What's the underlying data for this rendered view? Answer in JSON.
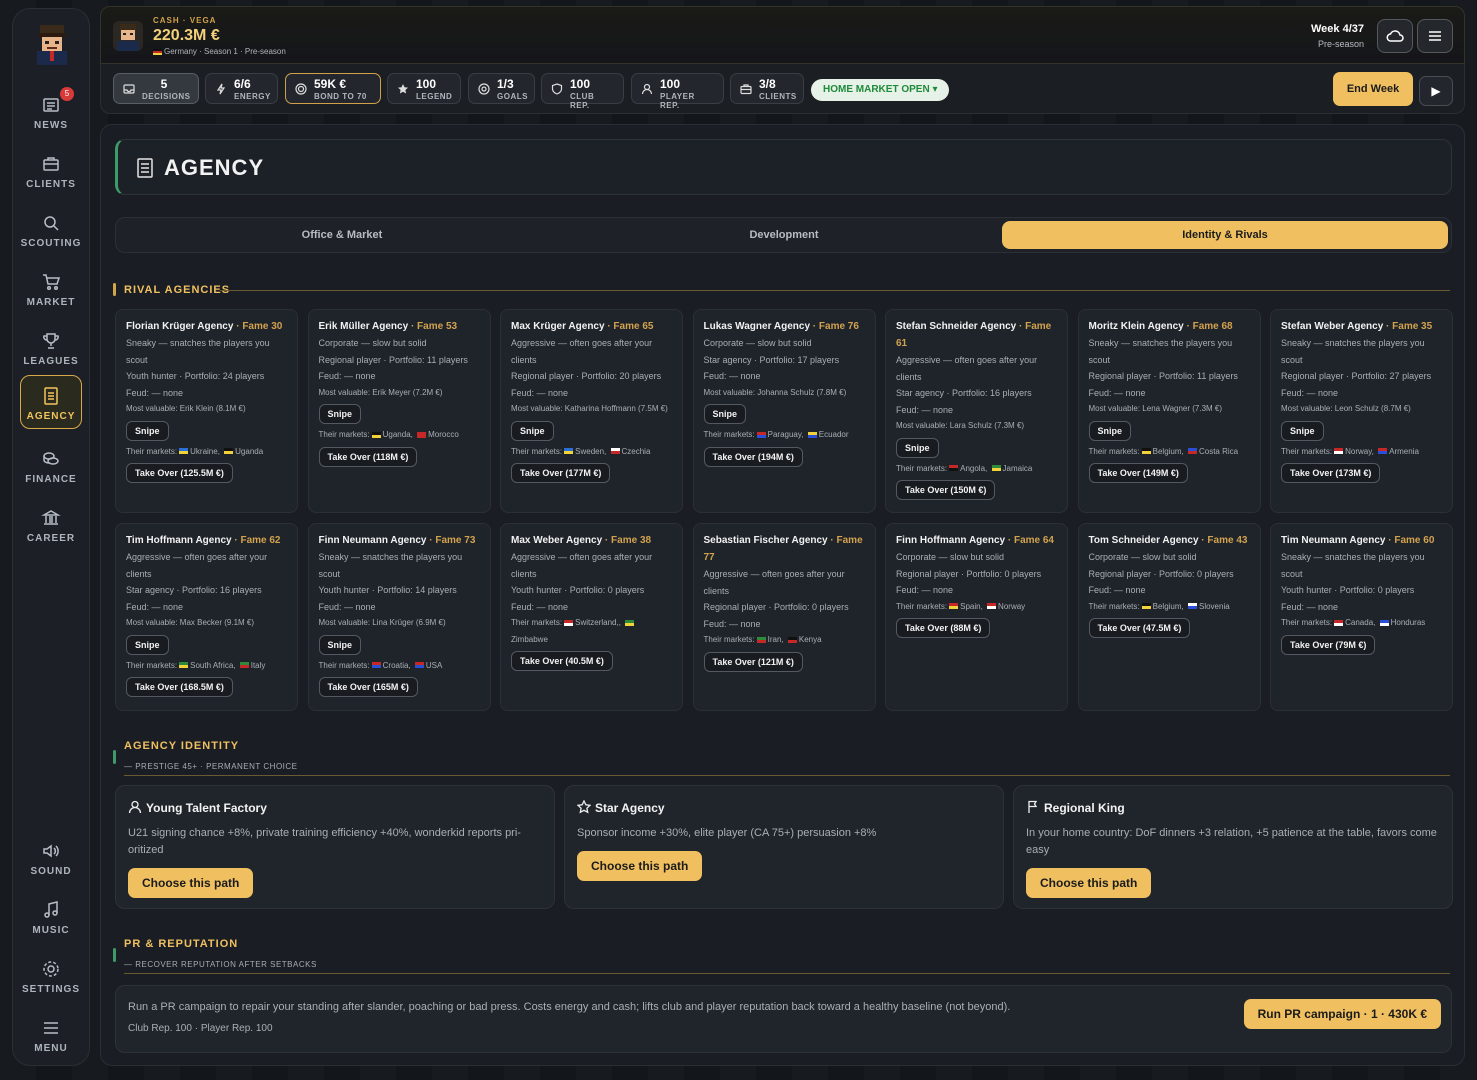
{
  "nav": [
    {
      "label": "NEWS",
      "icon": "news-icon",
      "badge": "5"
    },
    {
      "label": "CLIENTS",
      "icon": "briefcase-icon"
    },
    {
      "label": "SCOUTING",
      "icon": "search-icon"
    },
    {
      "label": "MARKET",
      "icon": "cart-icon"
    },
    {
      "label": "LEAGUES",
      "icon": "trophy-icon"
    },
    {
      "label": "AGENCY",
      "icon": "document-icon"
    },
    {
      "label": "FINANCE",
      "icon": "coins-icon"
    },
    {
      "label": "CAREER",
      "icon": "bank-icon"
    },
    {
      "label": "SOUND",
      "icon": "speaker-icon"
    },
    {
      "label": "MUSIC",
      "icon": "music-icon"
    },
    {
      "label": "SETTINGS",
      "icon": "gear-icon"
    },
    {
      "label": "MENU",
      "icon": "menu-icon"
    }
  ],
  "header": {
    "cash_label": "CASH · VEGA",
    "cash_value": "220.3M €",
    "sub": "Germany · Season 1 · Pre-season",
    "week": "Week 4/37",
    "phase": "Pre-season"
  },
  "stats": [
    {
      "value": "5",
      "label": "DECISIONS",
      "icon": "inbox-icon"
    },
    {
      "value": "6/6",
      "label": "ENERGY",
      "icon": "bolt-icon"
    },
    {
      "value": "59K €",
      "label": "BOND TO 70",
      "icon": "coin-icon"
    },
    {
      "value": "100",
      "label": "LEGEND",
      "icon": "star-icon"
    },
    {
      "value": "1/3",
      "label": "GOALS",
      "icon": "target-icon"
    },
    {
      "value": "100",
      "label": "CLUB REP.",
      "icon": "shield-icon"
    },
    {
      "value": "100",
      "label": "PLAYER REP.",
      "icon": "user-icon"
    },
    {
      "value": "3/8",
      "label": "CLIENTS",
      "icon": "briefcase-icon"
    }
  ],
  "market_status": "HOME MARKET OPEN ▾",
  "end_week": "End Week",
  "page_title": "AGENCY",
  "tabs": [
    "Office & Market",
    "Development",
    "Identity & Rivals"
  ],
  "rivals_title": "RIVAL AGENCIES",
  "rivals": [
    {
      "name": "Florian Krüger Agency",
      "fame": " · Fame 30",
      "lines": [
        "Sneaky — snatches the players you scout",
        "Youth hunter · Portfolio: 24 players",
        "Feud: — none"
      ],
      "valuable": "Most valuable: Erik Klein (8.1M €)",
      "snipe": "Snipe",
      "markets": "Their markets:",
      "m1": "Ukraine",
      "m2": "Uganda",
      "f1": [
        "#2a6fd6",
        "#f2d23a"
      ],
      "f2": [
        "#111",
        "#f2d23a"
      ],
      "takeover": "Take Over (125.5M €)"
    },
    {
      "name": "Erik Müller Agency",
      "fame": " · Fame 53",
      "lines": [
        "Corporate — slow but solid",
        "Regional player · Portfolio: 11 players",
        "Feud: — none"
      ],
      "valuable": "Most valuable: Erik Meyer (7.2M €)",
      "snipe": "Snipe",
      "markets": "Their markets:",
      "m1": "Uganda",
      "m2": "Morocco",
      "f1": [
        "#111",
        "#f2d23a"
      ],
      "f2": [
        "#c62828",
        "#c62828"
      ],
      "takeover": "Take Over (118M €)"
    },
    {
      "name": "Max Krüger Agency",
      "fame": " · Fame 65",
      "lines": [
        "Aggressive — often goes after your clients",
        "Regional player · Portfolio: 20 players",
        "Feud: — none"
      ],
      "valuable": "Most valuable: Katharina Hoffmann (7.5M €)",
      "snipe": "Snipe",
      "markets": "Their markets:",
      "m1": "Sweden",
      "m2": "Czechia",
      "f1": [
        "#2a6fd6",
        "#f2d23a"
      ],
      "f2": [
        "#fff",
        "#c62828"
      ],
      "takeover": "Take Over (177M €)"
    },
    {
      "name": "Lukas Wagner Agency",
      "fame": " · Fame 76",
      "lines": [
        "Corporate — slow but solid",
        "Star agency · Portfolio: 17 players",
        "Feud: — none"
      ],
      "valuable": "Most valuable: Johanna Schulz (7.8M €)",
      "snipe": "Snipe",
      "markets": "Their markets:",
      "m1": "Paraguay",
      "m2": "Ecuador",
      "f1": [
        "#c62828",
        "#2a4fd6"
      ],
      "f2": [
        "#f2d23a",
        "#2a4fd6"
      ],
      "takeover": "Take Over (194M €)"
    },
    {
      "name": "Stefan Schneider Agency",
      "fame": " · Fame 61",
      "lines": [
        "Aggressive — often goes after your clients",
        "Star agency · Portfolio: 16 players",
        "Feud: — none"
      ],
      "valuable": "Most valuable: Lara Schulz (7.3M €)",
      "snipe": "Snipe",
      "markets": "Their markets:",
      "m1": "Angola",
      "m2": "Jamaica",
      "f1": [
        "#c62828",
        "#111"
      ],
      "f2": [
        "#2e8b3a",
        "#f2d23a"
      ],
      "takeover": "Take Over (150M €)"
    },
    {
      "name": "Moritz Klein Agency",
      "fame": " · Fame 68",
      "lines": [
        "Sneaky — snatches the players you scout",
        "Regional player · Portfolio: 11 players",
        "Feud: — none"
      ],
      "valuable": "Most valuable: Lena Wagner (7.3M €)",
      "snipe": "Snipe",
      "markets": "Their markets:",
      "m1": "Belgium",
      "m2": "Costa Rica",
      "f1": [
        "#111",
        "#f2d23a"
      ],
      "f2": [
        "#2a4fd6",
        "#c62828"
      ],
      "takeover": "Take Over (149M €)"
    },
    {
      "name": "Stefan Weber Agency",
      "fame": " · Fame 35",
      "lines": [
        "Sneaky — snatches the players you scout",
        "Regional player · Portfolio: 27 players",
        "Feud: — none"
      ],
      "valuable": "Most valuable: Leon Schulz (8.7M €)",
      "snipe": "Snipe",
      "markets": "Their markets:",
      "m1": "Norway",
      "m2": "Armenia",
      "f1": [
        "#c62828",
        "#fff"
      ],
      "f2": [
        "#c62828",
        "#2a4fd6"
      ],
      "takeover": "Take Over (173M €)"
    },
    {
      "name": "Tim Hoffmann Agency",
      "fame": " · Fame 62",
      "lines": [
        "Aggressive — often goes after your clients",
        "Star agency · Portfolio: 16 players",
        "Feud: — none"
      ],
      "valuable": "Most valuable: Max Becker (9.1M €)",
      "snipe": "Snipe",
      "markets": "Their markets:",
      "m1": "South Africa",
      "m2": "Italy",
      "f1": [
        "#2e8b3a",
        "#f2d23a"
      ],
      "f2": [
        "#2e8b3a",
        "#c62828"
      ],
      "takeover": "Take Over (168.5M €)"
    },
    {
      "name": "Finn Neumann Agency",
      "fame": " · Fame 73",
      "lines": [
        "Sneaky — snatches the players you scout",
        "Youth hunter · Portfolio: 14 players",
        "Feud: — none"
      ],
      "valuable": "Most valuable: Lina Krüger (6.9M €)",
      "snipe": "Snipe",
      "markets": "Their markets:",
      "m1": "Croatia",
      "m2": "USA",
      "f1": [
        "#c62828",
        "#2a4fd6"
      ],
      "f2": [
        "#c62828",
        "#2a4fd6"
      ],
      "takeover": "Take Over (165M €)"
    },
    {
      "name": "Max Weber Agency",
      "fame": " · Fame 38",
      "lines": [
        "Aggressive — often goes after your clients",
        "Youth hunter · Portfolio: 0 players",
        "Feud: — none"
      ],
      "valuable": "",
      "snipe": "",
      "markets": "Their markets:",
      "m1": "Switzerland,",
      "m2": "Zimbabwe",
      "f1": [
        "#c62828",
        "#fff"
      ],
      "f2": [
        "#2e8b3a",
        "#f2d23a"
      ],
      "takeover": "Take Over (40.5M €)"
    },
    {
      "name": "Sebastian Fischer Agency",
      "fame": " · Fame 77",
      "lines": [
        "Aggressive — often goes after your clients",
        "Regional player · Portfolio: 0 players",
        "Feud: — none"
      ],
      "valuable": "",
      "snipe": "",
      "markets": "Their markets:",
      "m1": "Iran",
      "m2": "Kenya",
      "f1": [
        "#2e8b3a",
        "#c62828"
      ],
      "f2": [
        "#111",
        "#c62828"
      ],
      "takeover": "Take Over (121M €)"
    },
    {
      "name": "Finn Hoffmann Agency",
      "fame": " · Fame 64",
      "lines": [
        "Corporate — slow but solid",
        "Regional player · Portfolio: 0 players",
        "Feud: — none"
      ],
      "valuable": "",
      "snipe": "",
      "markets": "Their markets:",
      "m1": "Spain",
      "m2": "Norway",
      "f1": [
        "#c62828",
        "#f2d23a"
      ],
      "f2": [
        "#c62828",
        "#fff"
      ],
      "takeover": "Take Over (88M €)"
    },
    {
      "name": "Tom Schneider Agency",
      "fame": " · Fame 43",
      "lines": [
        "Corporate — slow but solid",
        "Regional player · Portfolio: 0 players",
        "Feud: — none"
      ],
      "valuable": "",
      "snipe": "",
      "markets": "Their markets:",
      "m1": "Belgium",
      "m2": "Slovenia",
      "f1": [
        "#111",
        "#f2d23a"
      ],
      "f2": [
        "#fff",
        "#2a4fd6"
      ],
      "takeover": "Take Over (47.5M €)"
    },
    {
      "name": "Tim Neumann Agency",
      "fame": " · Fame 60",
      "lines": [
        "Sneaky — snatches the players you scout",
        "Youth hunter · Portfolio: 0 players",
        "Feud: — none"
      ],
      "valuable": "",
      "snipe": "",
      "markets": "Their markets:",
      "m1": "Canada",
      "m2": "Honduras",
      "f1": [
        "#c62828",
        "#fff"
      ],
      "f2": [
        "#2a4fd6",
        "#fff"
      ],
      "takeover": "Take Over (79M €)"
    }
  ],
  "identity": {
    "title": "AGENCY IDENTITY",
    "sub": "— PRESTIGE 45+ · PERMANENT CHOICE",
    "cards": [
      {
        "icon": "person-icon",
        "title": "Young Talent Factory",
        "desc": "U21 signing chance +8%, private training efficiency +40%, wonderkid reports pri­oritized",
        "btn": "Choose this path"
      },
      {
        "icon": "star-icon",
        "title": "Star Agency",
        "desc": "Sponsor income +30%, elite player (CA 75+) persuasion +8%",
        "btn": "Choose this path"
      },
      {
        "icon": "flag-icon",
        "title": "Regional King",
        "desc": "In your home country: DoF dinners +3 relation, +5 patience at the table, favors come easy",
        "btn": "Choose this path"
      }
    ]
  },
  "pr": {
    "title": "PR & REPUTATION",
    "sub": "— RECOVER REPUTATION AFTER SETBACKS",
    "desc": "Run a PR campaign to repair your standing after slander, poaching or bad press. Costs energy and cash; lifts club and player reputation back toward a healthy baseline (not beyond).",
    "rep": "Club Rep. 100 · Player Rep. 100",
    "btn": "Run PR campaign · 1 · 430K €"
  }
}
